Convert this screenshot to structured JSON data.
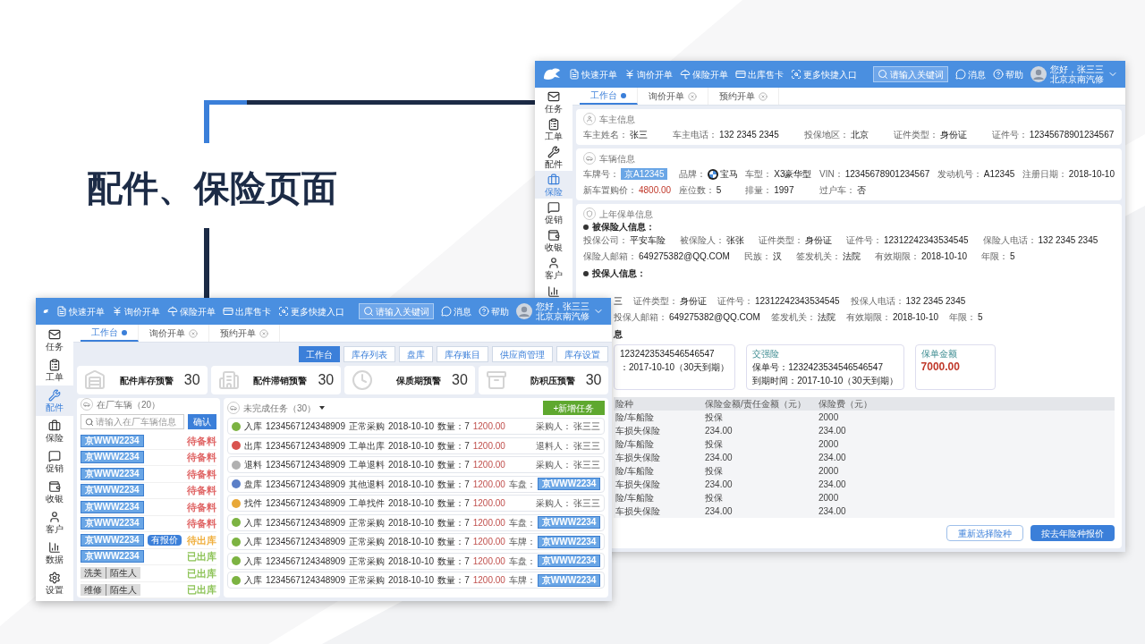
{
  "title": "配件、保险页面",
  "insurance_window": {
    "topbar": {
      "nav": [
        "快速开单",
        "询价开单",
        "保险开单",
        "出库售卡",
        "更多快捷入口"
      ],
      "search_placeholder": "请输入关键词",
      "messages": "消息",
      "help": "帮助",
      "greeting": "您好，张三三",
      "company": "北京京南汽修"
    },
    "sidebar": [
      {
        "label": "任务",
        "selected": false
      },
      {
        "label": "工单",
        "selected": false
      },
      {
        "label": "配件",
        "selected": false
      },
      {
        "label": "保险",
        "selected": true
      },
      {
        "label": "促销",
        "selected": false
      },
      {
        "label": "收银",
        "selected": false
      },
      {
        "label": "客户",
        "selected": false
      }
    ],
    "tabs": [
      {
        "label": "工作台",
        "selected": true,
        "closable": false
      },
      {
        "label": "询价开单",
        "selected": false,
        "closable": true
      },
      {
        "label": "预约开单",
        "selected": false,
        "closable": true
      }
    ],
    "owner": {
      "title": "车主信息",
      "fields": [
        {
          "label": "车主姓名：",
          "value": "张三"
        },
        {
          "label": "车主电话：",
          "value": "132 2345 2345"
        },
        {
          "label": "投保地区：",
          "value": "北京"
        },
        {
          "label": "证件类型：",
          "value": "身份证"
        },
        {
          "label": "证件号：",
          "value": "12345678901234567"
        }
      ]
    },
    "vehicle": {
      "title": "车辆信息",
      "fields": [
        {
          "label": "车牌号：",
          "value": "京A12345",
          "kind": "plate"
        },
        {
          "label": "品牌：",
          "value": "宝马",
          "kind": "brand"
        },
        {
          "label": "车型：",
          "value": "X3豪华型",
          "kind": "text"
        },
        {
          "label": "VIN：",
          "value": "12345678901234567",
          "kind": "text"
        },
        {
          "label": "发动机号：",
          "value": "A12345",
          "kind": "text"
        },
        {
          "label": "注册日期：",
          "value": "2018-10-10",
          "kind": "text"
        },
        {
          "label": "新车置购价：",
          "value": "4800.00",
          "kind": "price"
        },
        {
          "label": "座位数：",
          "value": "5",
          "kind": "text"
        },
        {
          "label": "排量：",
          "value": "1997",
          "kind": "text"
        },
        {
          "label": "过户车：",
          "value": "否",
          "kind": "text"
        }
      ]
    },
    "policy": {
      "title": "上年保单信息",
      "insured": {
        "heading": "被保险人信息：",
        "fields": [
          {
            "label": "投保公司：",
            "value": "平安车险"
          },
          {
            "label": "被保险人：",
            "value": "张张"
          },
          {
            "label": "证件类型：",
            "value": "身份证"
          },
          {
            "label": "证件号：",
            "value": "12312242343534545"
          },
          {
            "label": "保险人电话：",
            "value": "132 2345 2345"
          },
          {
            "label": "保险人邮箱：",
            "value": "649275382@QQ.COM"
          },
          {
            "label": "民族：",
            "value": "汉"
          },
          {
            "label": "签发机关：",
            "value": "法院"
          },
          {
            "label": "有效期限：",
            "value": "2018-10-10"
          },
          {
            "label": "年限：",
            "value": "5"
          }
        ]
      },
      "holder": {
        "heading": "投保人信息：",
        "fields": [
          {
            "value": "三"
          },
          {
            "label": "证件类型：",
            "value": "身份证"
          },
          {
            "label": "证件号：",
            "value": "12312242343534545"
          },
          {
            "label": "投保人电话：",
            "value": "132 2345 2345"
          },
          {
            "label": "投保人邮箱：",
            "value": "649275382@QQ.COM"
          },
          {
            "label": "签发机关：",
            "value": "法院"
          },
          {
            "label": "有效期限：",
            "value": "2018-10-10"
          },
          {
            "label": "年限：",
            "value": "5"
          }
        ]
      },
      "section_heading": "息",
      "cards": [
        {
          "kind": "lines",
          "lines": [
            "1232423534546546547",
            "：2017-10-10（30天到期）"
          ]
        },
        {
          "kind": "lines",
          "legend": "交强险",
          "lines": [
            "保单号：1232423534546546547",
            "到期时间：2017-10-10（30天到期）"
          ]
        },
        {
          "kind": "amount",
          "legend": "保单金额",
          "amount": "7000.00"
        }
      ],
      "table": {
        "columns": [
          "险种",
          "保险金额/责任金额（元）",
          "保险费（元）"
        ],
        "rows": [
          [
            "险/车船险",
            "投保",
            "2000"
          ],
          [
            "车损失保险",
            "234.00",
            "234.00"
          ],
          [
            "险/车船险",
            "投保",
            "2000"
          ],
          [
            "车损失保险",
            "234.00",
            "234.00"
          ],
          [
            "险/车船险",
            "投保",
            "2000"
          ],
          [
            "车损失保险",
            "234.00",
            "234.00"
          ],
          [
            "险/车船险",
            "投保",
            "2000"
          ],
          [
            "车损失保险",
            "234.00",
            "234.00"
          ]
        ]
      },
      "buttons": [
        {
          "label": "重新选择险种",
          "primary": false
        },
        {
          "label": "按去年险种报价",
          "primary": true
        }
      ]
    }
  },
  "parts_window": {
    "topbar": {
      "nav": [
        "快速开单",
        "询价开单",
        "保险开单",
        "出库售卡",
        "更多快捷入口"
      ],
      "search_placeholder": "请输入关键词",
      "messages": "消息",
      "help": "帮助",
      "greeting": "您好，张三三",
      "company": "北京京南汽修"
    },
    "sidebar": [
      {
        "label": "任务",
        "selected": false
      },
      {
        "label": "工单",
        "selected": false
      },
      {
        "label": "配件",
        "selected": true
      },
      {
        "label": "保险",
        "selected": false
      },
      {
        "label": "促销",
        "selected": false
      },
      {
        "label": "收银",
        "selected": false
      },
      {
        "label": "客户",
        "selected": false
      },
      {
        "label": "数据",
        "selected": false
      },
      {
        "label": "设置",
        "selected": false
      }
    ],
    "tabs": [
      {
        "label": "工作台",
        "selected": true,
        "closable": false
      },
      {
        "label": "询价开单",
        "selected": false,
        "closable": true
      },
      {
        "label": "预约开单",
        "selected": false,
        "closable": true
      }
    ],
    "toolbar": [
      {
        "label": "工作台",
        "selected": true
      },
      {
        "label": "库存列表",
        "selected": false
      },
      {
        "label": "盘库",
        "selected": false
      },
      {
        "label": "库存账目",
        "selected": false
      },
      {
        "label": "供应商管理",
        "selected": false
      },
      {
        "label": "库存设置",
        "selected": false
      }
    ],
    "stats": [
      {
        "label": "配件库存预警",
        "value": "30"
      },
      {
        "label": "配件滞销预警",
        "value": "30"
      },
      {
        "label": "保质期预警",
        "value": "30"
      },
      {
        "label": "防积压预警",
        "value": "30"
      }
    ],
    "vehicles": {
      "title": "在厂车辆（20）",
      "search_placeholder": "请输入在厂车辆信息",
      "confirm": "确认",
      "items": [
        {
          "kind": "plate",
          "plate": "京WWW2234",
          "status": "待备料",
          "color": "#e06666"
        },
        {
          "kind": "plate",
          "plate": "京WWW2234",
          "status": "待备料",
          "color": "#e06666"
        },
        {
          "kind": "plate",
          "plate": "京WWW2234",
          "status": "待备料",
          "color": "#e06666"
        },
        {
          "kind": "plate",
          "plate": "京WWW2234",
          "status": "待备料",
          "color": "#e06666"
        },
        {
          "kind": "plate",
          "plate": "京WWW2234",
          "status": "待备料",
          "color": "#e06666"
        },
        {
          "kind": "plate",
          "plate": "京WWW2234",
          "status": "待备料",
          "color": "#e06666"
        },
        {
          "kind": "plate",
          "plate": "京WWW2234",
          "tag": "有报价",
          "status": "待出库",
          "color": "#f0b040"
        },
        {
          "kind": "plate",
          "plate": "京WWW2234",
          "status": "已出库",
          "color": "#8fc45a"
        },
        {
          "kind": "service",
          "service": "洗美",
          "customer": "陌生人",
          "status": "已出库",
          "color": "#8fc45a"
        },
        {
          "kind": "service",
          "service": "维修",
          "customer": "陌生人",
          "status": "已出库",
          "color": "#8fc45a"
        }
      ]
    },
    "tasks": {
      "title": "未完成任务（30）",
      "new_button": "+新增任务",
      "rows": [
        {
          "type": "入库",
          "color": "#7cb342",
          "code": "1234567124348909",
          "category": "正常采购",
          "date": "2018-10-10",
          "qty": "数量：7",
          "price": "1200.00",
          "person_label": "采购人：",
          "kind": "person",
          "person": "张三三"
        },
        {
          "type": "出库",
          "color": "#d9534f",
          "code": "1234567124348909",
          "category": "工单出库",
          "date": "2018-10-10",
          "qty": "数量：7",
          "price": "1200.00",
          "person_label": "退料人：",
          "kind": "person",
          "person": "张三三"
        },
        {
          "type": "退料",
          "color": "#b0b0b0",
          "code": "1234567124348909",
          "category": "工单退料",
          "date": "2018-10-10",
          "qty": "数量：7",
          "price": "1200.00",
          "person_label": "采购人：",
          "kind": "person",
          "person": "张三三"
        },
        {
          "type": "盘库",
          "color": "#5b7fc7",
          "code": "1234567124348909",
          "category": "其他退料",
          "date": "2018-10-10",
          "qty": "数量：7",
          "price": "1200.00",
          "person_label": "车盘：",
          "kind": "plate",
          "person": "京WWW2234"
        },
        {
          "type": "找件",
          "color": "#e8a838",
          "code": "1234567124348909",
          "category": "工单找件",
          "date": "2018-10-10",
          "qty": "数量：7",
          "price": "1200.00",
          "person_label": "采购人：",
          "kind": "person",
          "person": "张三三"
        },
        {
          "type": "入库",
          "color": "#7cb342",
          "code": "1234567124348909",
          "category": "正常采购",
          "date": "2018-10-10",
          "qty": "数量：7",
          "price": "1200.00",
          "person_label": "车盘：",
          "kind": "plate",
          "person": "京WWW2234"
        },
        {
          "type": "入库",
          "color": "#7cb342",
          "code": "1234567124348909",
          "category": "正常采购",
          "date": "2018-10-10",
          "qty": "数量：7",
          "price": "1200.00",
          "person_label": "车牌：",
          "kind": "plate",
          "person": "京WWW2234"
        },
        {
          "type": "入库",
          "color": "#7cb342",
          "code": "1234567124348909",
          "category": "正常采购",
          "date": "2018-10-10",
          "qty": "数量：7",
          "price": "1200.00",
          "person_label": "车盘：",
          "kind": "plate",
          "person": "京WWW2234"
        },
        {
          "type": "入库",
          "color": "#7cb342",
          "code": "1234567124348909",
          "category": "正常采购",
          "date": "2018-10-10",
          "qty": "数量：7",
          "price": "1200.00",
          "person_label": "车牌：",
          "kind": "plate",
          "person": "京WWW2234"
        }
      ]
    }
  }
}
